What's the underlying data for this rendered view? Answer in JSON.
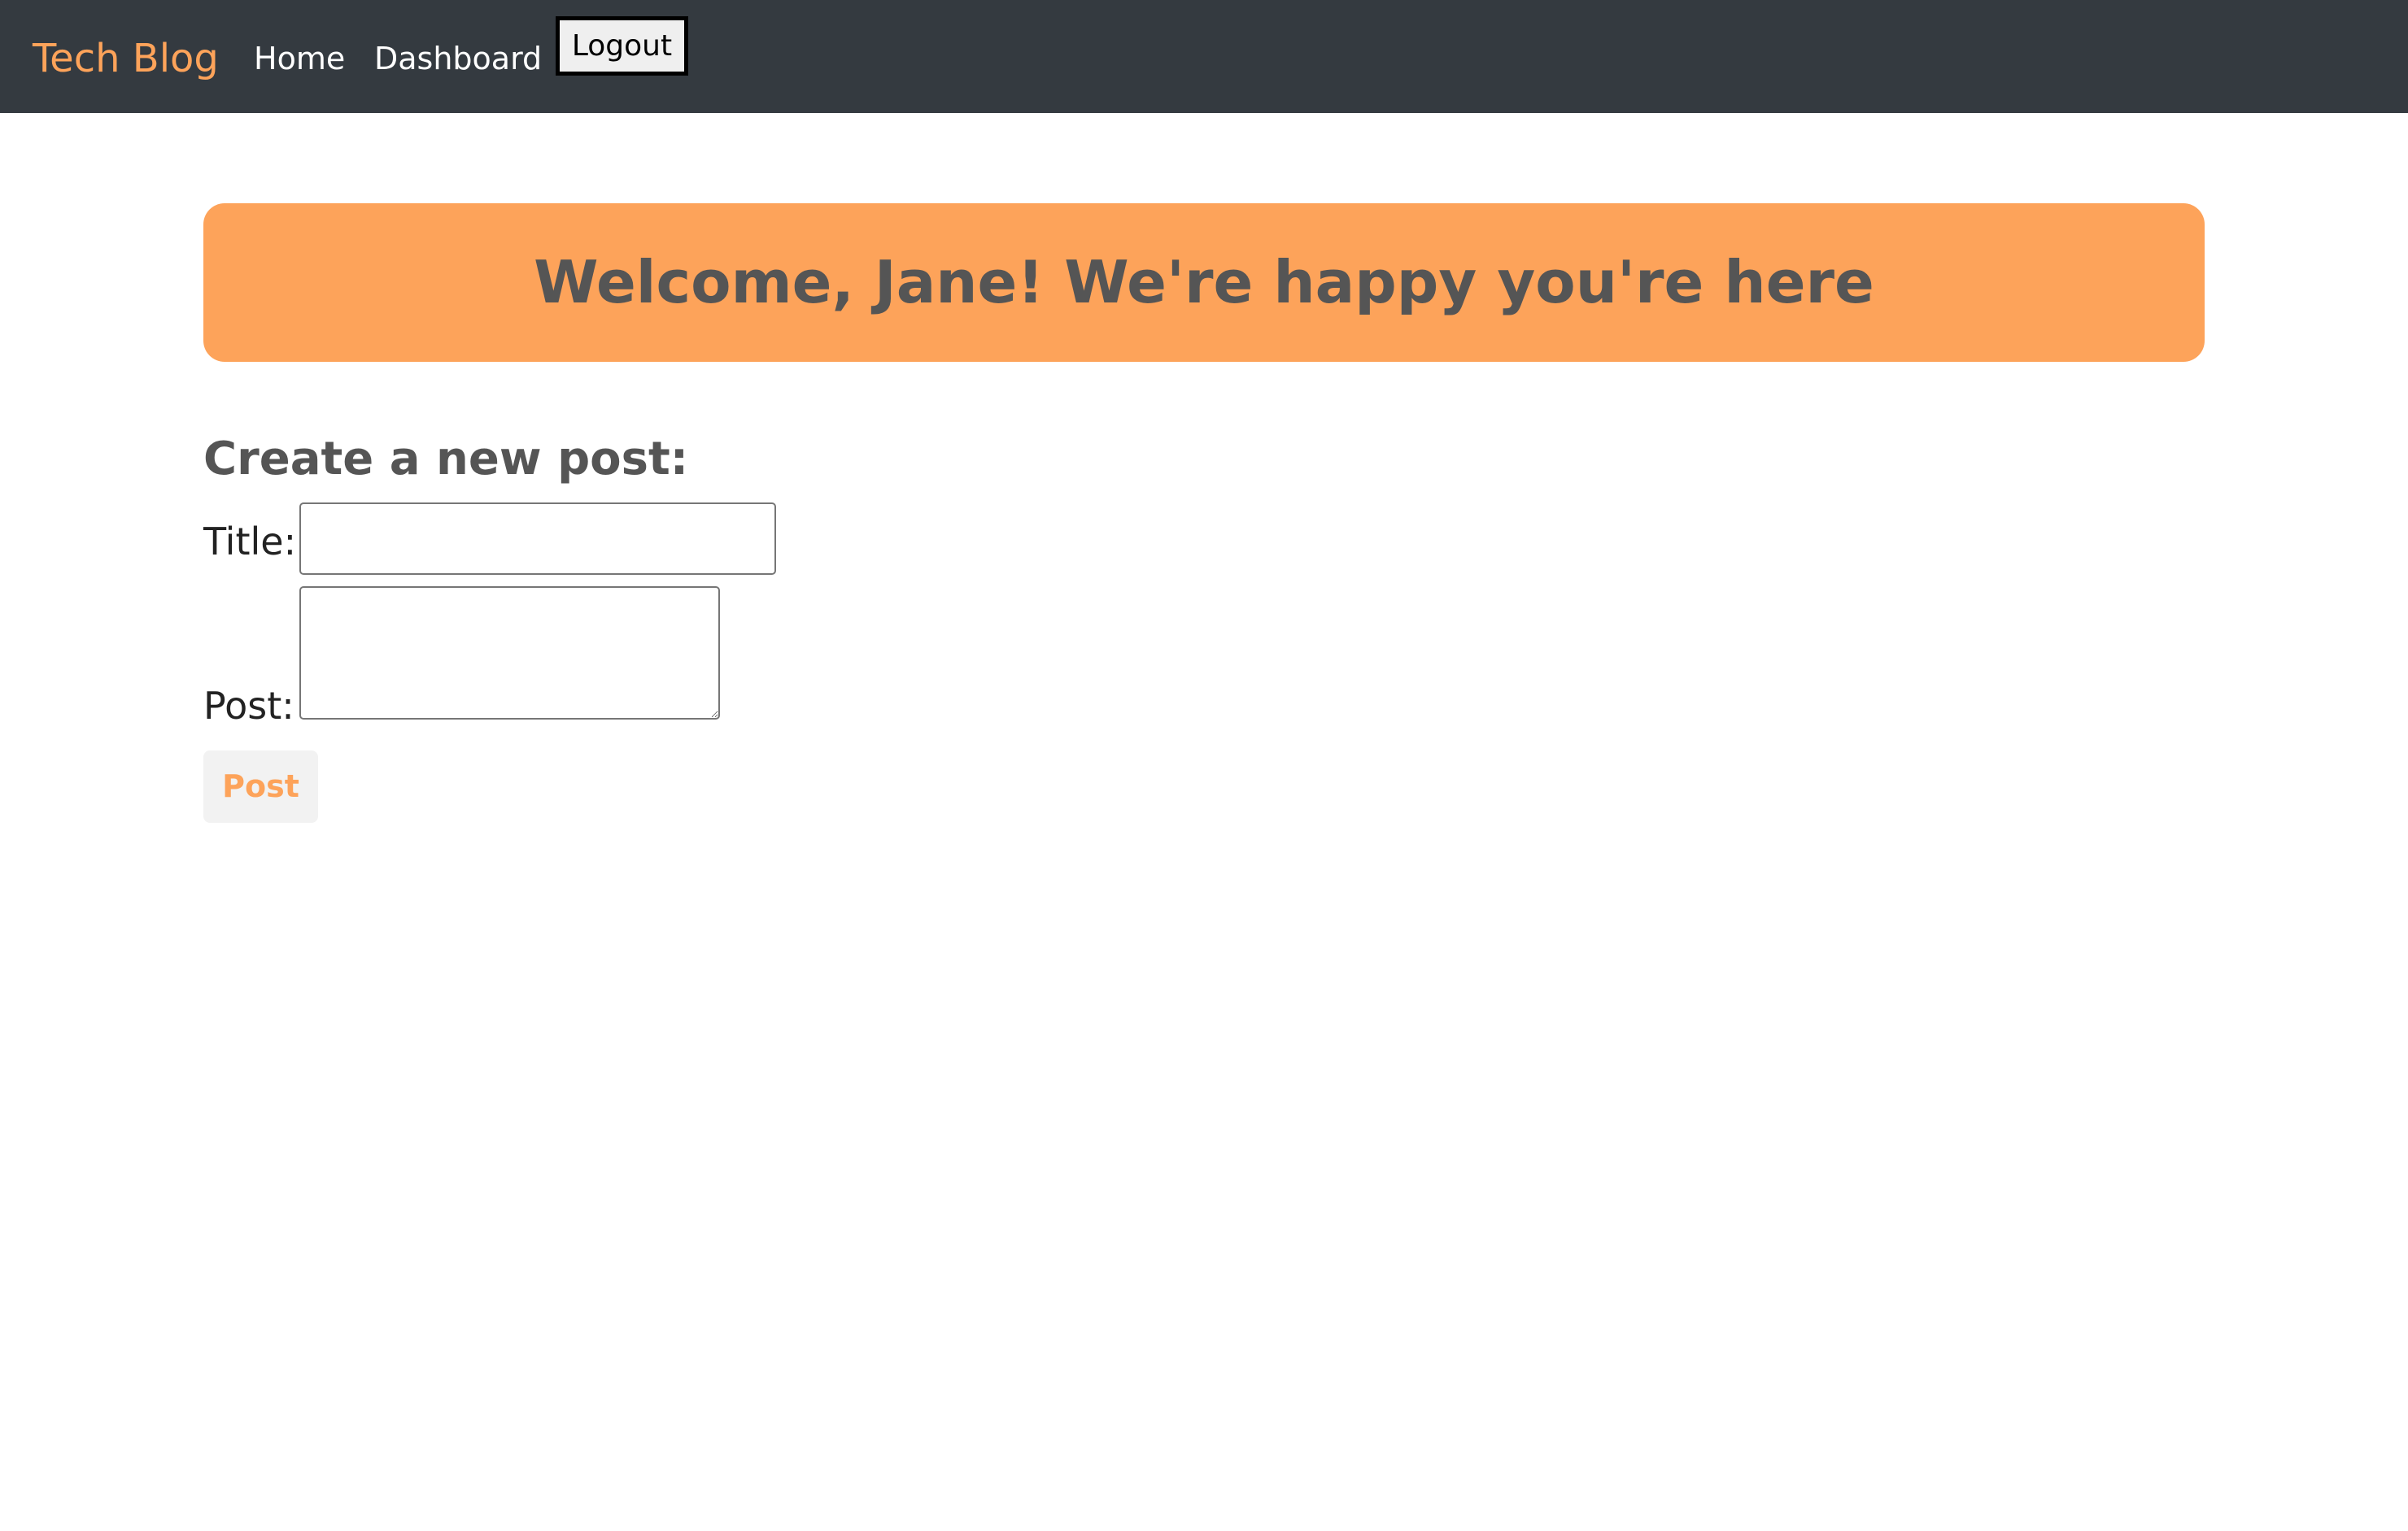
{
  "navbar": {
    "brand": "Tech Blog",
    "links": [
      "Home",
      "Dashboard"
    ],
    "logout_label": "Logout"
  },
  "banner": {
    "text": "Welcome, Jane! We're happy you're here"
  },
  "form": {
    "heading": "Create a new post:",
    "title_label": "Title:",
    "title_value": "",
    "post_label": "Post:",
    "post_value": "",
    "submit_label": "Post"
  },
  "colors": {
    "navbar_bg": "#343a40",
    "accent": "#fda35a",
    "heading_text": "#555555",
    "button_bg": "#f2f2f2"
  }
}
